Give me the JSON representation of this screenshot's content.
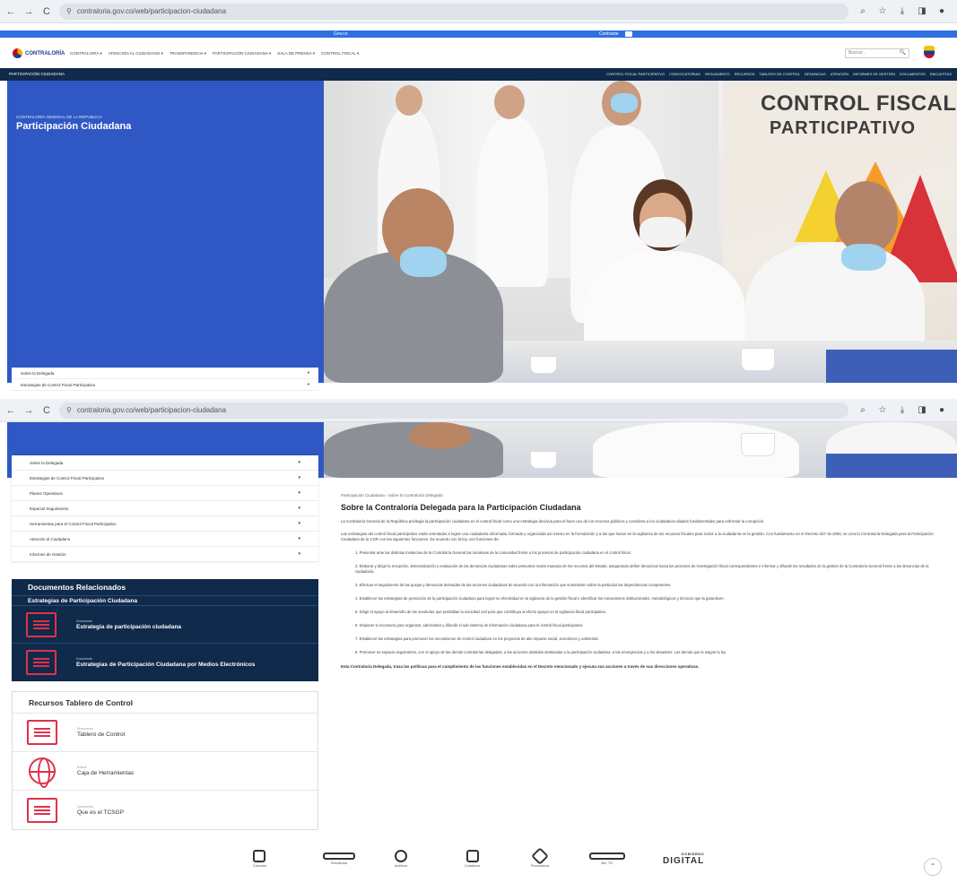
{
  "browser": {
    "url": "contraloria.gov.co/web/participacion-ciudadana",
    "back": "←",
    "forward": "→",
    "reload": "C"
  },
  "gov_bar": {
    "left_link": "Gov.co",
    "right_link": "Contraste"
  },
  "header": {
    "logo_text": "CONTRALORÍA",
    "nav_items": [
      "CONTRALORÍA ▾",
      "ATENCIÓN AL CIUDADANO ▾",
      "TRANSPARENCIA ▾",
      "PARTICIPACIÓN CIUDADANA ▾",
      "SALA DE PRENSA ▾",
      "CONTROL FISCAL ▾"
    ],
    "search_placeholder": "Buscar...",
    "search_icon": "🔍"
  },
  "subnav": {
    "brand": "PARTICIPACIÓN CIUDADANA",
    "links": [
      "CONTROL FISCAL PARTICIPATIVO",
      "CONVOCATORIAS",
      "SEGUIMIENTO",
      "RECURSOS",
      "TABLERO DE CONTROL",
      "DENUNCIAS",
      "ATENCIÓN",
      "INFORMES DE GESTIÓN",
      "DOCUMENTOS",
      "ENCUESTAS"
    ]
  },
  "hero": {
    "kicker": "CONTRALORÍA GENERAL DE LA REPÚBLICA",
    "title": "Participación Ciudadana",
    "banner_line1": "CONTROL FISCAL",
    "banner_line2": "PARTICIPATIVO"
  },
  "accordion_top": [
    {
      "label": "Sobre la Delegada",
      "chev": "▾"
    },
    {
      "label": "Estrategias de Control Fiscal Participativo",
      "chev": "▾"
    }
  ],
  "accordion": [
    {
      "label": "Sobre la Delegada",
      "chev": "▾"
    },
    {
      "label": "Estrategias de Control Fiscal Participativo",
      "chev": "▾"
    },
    {
      "label": "Planes Operativos",
      "chev": "▾"
    },
    {
      "label": "Especial Seguimiento",
      "chev": "▾"
    },
    {
      "label": "Herramientas para el Control Fiscal Participativo",
      "chev": "▾"
    },
    {
      "label": "Atención al Ciudadano",
      "chev": "▾"
    },
    {
      "label": "Informes de Gestión",
      "chev": "▾"
    }
  ],
  "docs": {
    "title": "Documentos Relacionados",
    "subtitle": "Estrategias de Participación Ciudadana",
    "items": [
      {
        "kind": "Documento",
        "name": "Estrategia de participación ciudadana"
      },
      {
        "kind": "Documento",
        "name": "Estrategias de Participación Ciudadana por Medios Electrónicos"
      }
    ]
  },
  "resources": {
    "title": "Recursos Tablero de Control",
    "items": [
      {
        "kind": "Documento",
        "name": "Tablero de Control",
        "icon": "document-icon"
      },
      {
        "kind": "Enlace",
        "name": "Caja de Herramientas",
        "icon": "globe-icon"
      },
      {
        "kind": "Documento",
        "name": "Que es el TCSGP",
        "icon": "document-icon"
      }
    ]
  },
  "content": {
    "breadcrumb": "Participación Ciudadana  ›  Sobre la Contraloría Delegada",
    "title": "Sobre la Contraloría Delegada para la Participación Ciudadana",
    "para1": "La Contraloría General de la República privilegia la participación ciudadana en el control fiscal como una estrategia decisiva para el buen uso de los recursos públicos y considera a los ciudadanos aliados fundamentales para enfrentar la corrupción.",
    "para2": "Las estrategias del control fiscal participativo están orientadas a lograr una ciudadanía informada, formada y organizada así mismo en la formulación y a las que hacen en la vigilancia de los recursos fiscales para incluir a la ciudadanía en la gestión. Con fundamento en el Decreto 267 de 2000, se crea la Contraloría Delegada para la Participación Ciudadana de la CGR con las siguientes funciones. De acuerdo con la ley, son funciones de:",
    "items": [
      "1. Presentar ante las distintas instancias de la Contraloría General las iniciativas de la comunidad frente a los procesos de participación ciudadana en el control fiscal.",
      "2. Elaborar y dirigir la recepción, sistematización y evaluación de las denuncias ciudadanas sobre presuntos malos manejos de los recursos del Estado, asegurando definir denuncias hacia los procesos de investigación fiscal correspondientes e informar y difundir los resultados de la gestión de la Contraloría General frente a las denuncias de la ciudadanía.",
      "3. Efectuar el seguimiento de las quejas y denuncias derivadas de las acciones ciudadanas de acuerdo con la información que suministren sobre la particular las dependencias competentes.",
      "4. Establecer las estrategias de promoción de la participación ciudadana para lograr su efectividad en la vigilancia de la gestión fiscal e identificar los mecanismos institucionales, metodológicos y técnicos que la garanticen.",
      "5. Dirigir el apoyo al desarrollo de las veedurías que posibilitan la sociedad civil para que contribuya al efecto apoyar en la vigilancia fiscal participativa.",
      "6. Disponer lo necesario para organizar, administrar y difundir el sub sistema de información ciudadana para el control fiscal participativo.",
      "7. Establecer las estrategias para promover los mecanismos de control ciudadano en los proyectos de alto impacto social, económico y ambiental.",
      "8. Promover un espacio seguimiento, con el apoyo de las demás contralorías delegadas, a las acciones asistidas destinadas a la participación ciudadana, a las emergencias y a los desastres. Las demás que le asigne la ley."
    ],
    "closing": "Esta Contraloría Delegada, traza las políticas para el cumplimiento de las funciones establecidas en el Decreto mencionado y ejecuta sus acciones a través de sus direcciones operativas."
  },
  "footer": {
    "logo_captions": [
      "Colombia",
      "Presidencia",
      "Auditoría",
      "Contaduría",
      "Procuraduría",
      "Min. TIC"
    ],
    "digital_top": "GOBIERNO",
    "digital": "DIGITAL",
    "scroll_top": "⌃"
  }
}
